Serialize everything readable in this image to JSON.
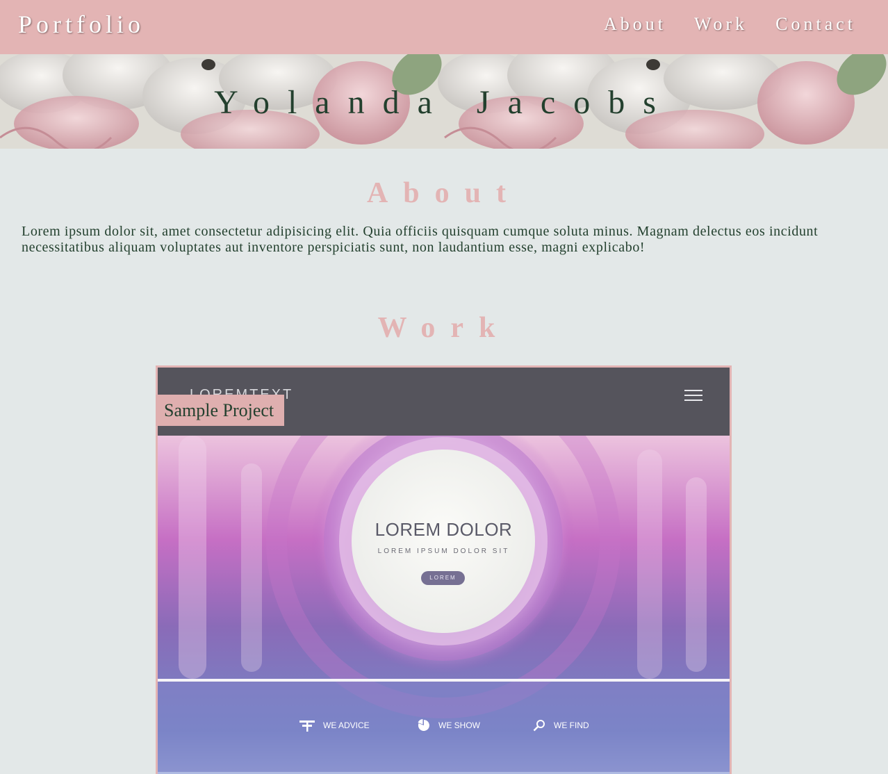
{
  "header": {
    "brand": "Portfolio",
    "nav": [
      "About",
      "Work",
      "Contact"
    ]
  },
  "hero": {
    "title": "Yolanda Jacobs"
  },
  "about": {
    "title": "About",
    "text": "Lorem ipsum dolor sit, amet consectetur adipisicing elit. Quia officiis quisquam cumque soluta minus. Magnam delectus eos incidunt necessitatibus aliquam voluptates aut inventore perspiciatis sunt, non laudantium esse, magni explicabo!"
  },
  "work": {
    "title": "Work",
    "project": {
      "label": "Sample Project",
      "preview": {
        "logo": "LOREMTEXT",
        "heading": "LOREM DOLOR",
        "subheading": "LOREM IPSUM DOLOR SIT",
        "button": "LOREM",
        "features": [
          {
            "icon": "signpost-icon",
            "label": "WE ADVICE"
          },
          {
            "icon": "pie-chart-icon",
            "label": "WE SHOW"
          },
          {
            "icon": "magnifier-icon",
            "label": "WE FIND"
          }
        ]
      }
    }
  },
  "colors": {
    "accent_pink": "#e3b4b4",
    "background": "#e3e8e8",
    "text_green": "#23402e",
    "preview_nav": "#55545c"
  }
}
